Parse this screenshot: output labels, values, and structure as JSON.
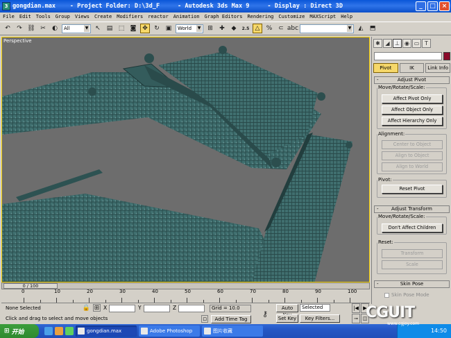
{
  "window": {
    "title": "gongdian.max    - Project Folder: D:\\3d_F     - Autodesk 3ds Max 9     - Display : Direct 3D"
  },
  "menu": [
    "File",
    "Edit",
    "Tools",
    "Group",
    "Views",
    "Create",
    "Modifiers",
    "reactor",
    "Animation",
    "Graph Editors",
    "Rendering",
    "Customize",
    "MAXScript",
    "Help"
  ],
  "toolbar": {
    "filter_value": "All",
    "coord_value": "World",
    "snap_value": "2.5"
  },
  "viewport": {
    "label": "Perspective"
  },
  "panel": {
    "subtabs": [
      "Pivot",
      "IK",
      "Link Info"
    ],
    "adjust_pivot": {
      "title": "Adjust Pivot",
      "move_rotate_scale": "Move/Rotate/Scale:",
      "buttons": [
        "Affect Pivot Only",
        "Affect Object Only",
        "Affect Hierarchy Only"
      ],
      "alignment": "Alignment:",
      "align_buttons": [
        "Center to Object",
        "Align to Object",
        "Align to World"
      ],
      "pivot": "Pivot:",
      "reset_pivot": "Reset Pivot"
    },
    "adjust_transform": {
      "title": "Adjust Transform",
      "move_rotate_scale": "Move/Rotate/Scale:",
      "dont_affect": "Don't Affect Children",
      "reset": "Reset:",
      "transform": "Transform",
      "scale": "Scale"
    },
    "skin_pose": {
      "title": "Skin Pose",
      "mode": "Skin Pose Mode"
    }
  },
  "timeline": {
    "slider_text": "0 / 100",
    "ticks": [
      "0",
      "10",
      "20",
      "30",
      "40",
      "50",
      "60",
      "70",
      "80",
      "90",
      "100"
    ]
  },
  "status": {
    "selection": "None Selected",
    "prompt": "Click and drag to select and move objects",
    "x_label": "X",
    "y_label": "Y",
    "z_label": "Z",
    "grid": "Grid = 10.0",
    "add_time_tag": "Add Time Tag",
    "auto_key": "Auto Key",
    "selected": "Selected",
    "set_key": "Set Key",
    "key_filters": "Key Filters..."
  },
  "taskbar": {
    "start": "开始",
    "tasks": [
      "gongdian.max",
      "Adobe Photoshop",
      "图片收藏"
    ],
    "clock": "14:50"
  },
  "watermark": {
    "main": "CGUIT",
    "sub": "www.cgjoy.com"
  },
  "colors": {
    "roof": "#3f6e6e",
    "viewport_bg": "#6d6d6d",
    "active_border": "#f6d000",
    "object_color": "#8b0b2a"
  }
}
